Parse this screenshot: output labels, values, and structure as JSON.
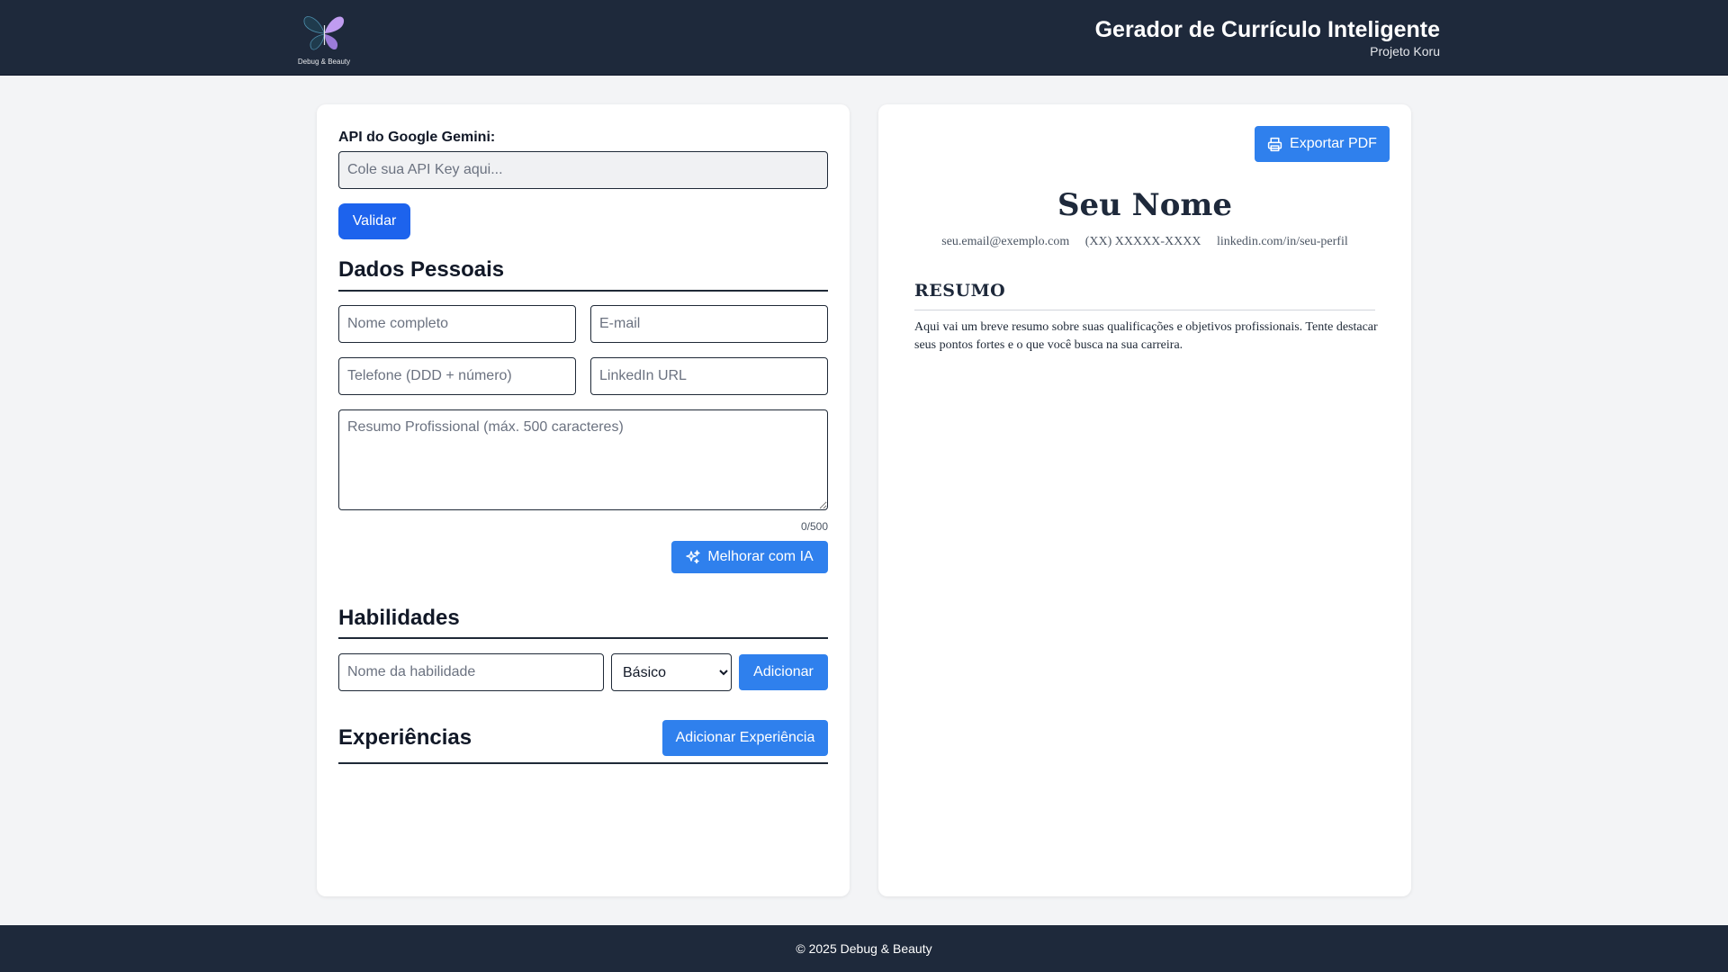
{
  "header": {
    "logo_text": "Debug & Beauty",
    "title": "Gerador de Currículo Inteligente",
    "subtitle": "Projeto Koru"
  },
  "form": {
    "api_label": "API do Google Gemini:",
    "api_placeholder": "Cole sua API Key aqui...",
    "validate_label": "Validar",
    "personal_title": "Dados Pessoais",
    "name_placeholder": "Nome completo",
    "email_placeholder": "E-mail",
    "phone_placeholder": "Telefone (DDD + número)",
    "linkedin_placeholder": "LinkedIn URL",
    "summary_placeholder": "Resumo Profissional (máx. 500 caracteres)",
    "char_count": "0/500",
    "improve_label": "Melhorar com IA",
    "skills_title": "Habilidades",
    "skill_placeholder": "Nome da habilidade",
    "skill_level_selected": "Básico",
    "add_skill_label": "Adicionar",
    "experience_title": "Experiências",
    "add_experience_label": "Adicionar Experiência"
  },
  "preview": {
    "export_label": "Exportar PDF",
    "name": "Seu Nome",
    "email": "seu.email@exemplo.com",
    "phone": "(XX) XXXXX-XXXX",
    "linkedin": "linkedin.com/in/seu-perfil",
    "summary_title": "RESUMO",
    "summary_text": "Aqui vai um breve resumo sobre suas qualificações e objetivos profissionais. Tente destacar seus pontos fortes e o que você busca na sua carreira."
  },
  "footer": {
    "text": "© 2025 Debug & Beauty"
  },
  "colors": {
    "header_bg": "#1e293b",
    "accent": "#2f80ed",
    "validate_bg": "#1d63ed",
    "page_bg": "#f3f4f6"
  },
  "icons": {
    "logo": "butterfly-icon",
    "improve": "sparkles-icon",
    "export": "printer-icon"
  }
}
